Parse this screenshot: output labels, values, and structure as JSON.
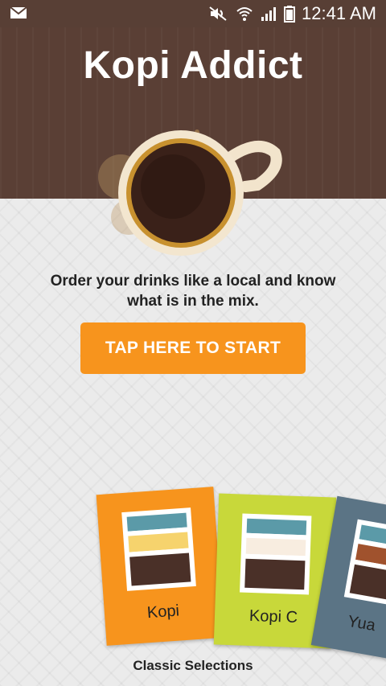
{
  "status_bar": {
    "time": "12:41 AM"
  },
  "header": {
    "title": "Kopi Addict"
  },
  "main": {
    "tagline": "Order your drinks like a local and know what is in the mix.",
    "start_button": "TAP HERE TO START"
  },
  "cards": [
    {
      "label": "Kopi"
    },
    {
      "label": "Kopi C"
    },
    {
      "label": "Yua"
    }
  ],
  "footer": {
    "section_label": "Classic Selections"
  },
  "colors": {
    "header_bg": "#5a3f35",
    "accent_orange": "#f7941d",
    "card_green": "#c8d83a",
    "card_slate": "#5b7485"
  }
}
